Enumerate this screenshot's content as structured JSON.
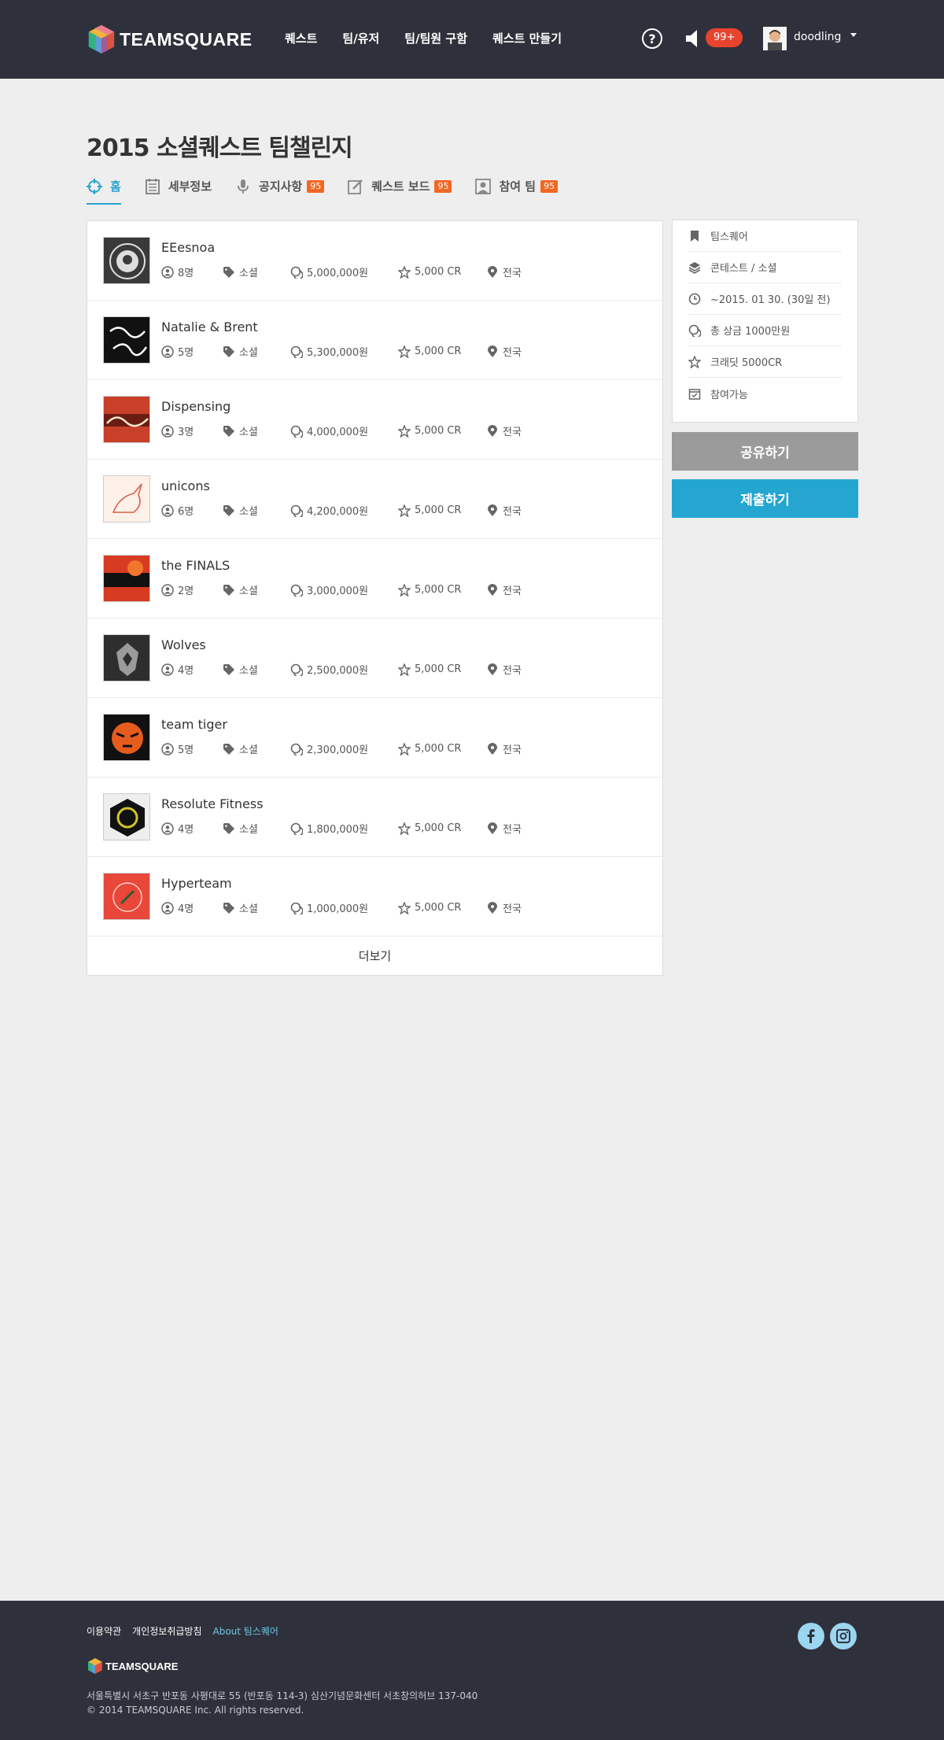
{
  "header": {
    "logo_text": "TEAMSQUARE",
    "nav": [
      "퀘스트",
      "팀/유저",
      "팀/팀원 구함",
      "퀘스트 만들기"
    ],
    "help_icon": "?",
    "notification_badge": "99+",
    "username": "doodling"
  },
  "page": {
    "title": "2015 소셜퀘스트 팀챌린지",
    "tabs": [
      {
        "label": "홈",
        "icon": "crosshair-icon"
      },
      {
        "label": "세부정보",
        "icon": "notepad-icon"
      },
      {
        "label": "공지사항",
        "icon": "microphone-icon",
        "badge": "95"
      },
      {
        "label": "퀘스트 보드",
        "icon": "edit-icon",
        "badge": "95"
      },
      {
        "label": "참여 팀",
        "icon": "person-icon",
        "badge": "95"
      }
    ]
  },
  "teams": [
    {
      "name": "EEesnoa",
      "members": "8명",
      "category": "소셜",
      "prize": "5,000,000원",
      "credit": "5,000 CR",
      "region": "전국"
    },
    {
      "name": "Natalie & Brent",
      "members": "5명",
      "category": "소셜",
      "prize": "5,300,000원",
      "credit": "5,000 CR",
      "region": "전국"
    },
    {
      "name": "Dispensing",
      "members": "3명",
      "category": "소셜",
      "prize": "4,000,000원",
      "credit": "5,000 CR",
      "region": "전국"
    },
    {
      "name": "unicons",
      "members": "6명",
      "category": "소셜",
      "prize": "4,200,000원",
      "credit": "5,000 CR",
      "region": "전국"
    },
    {
      "name": "the FINALS",
      "members": "2명",
      "category": "소셜",
      "prize": "3,000,000원",
      "credit": "5,000 CR",
      "region": "전국"
    },
    {
      "name": "Wolves",
      "members": "4명",
      "category": "소셜",
      "prize": "2,500,000원",
      "credit": "5,000 CR",
      "region": "전국"
    },
    {
      "name": "team tiger",
      "members": "5명",
      "category": "소셜",
      "prize": "2,300,000원",
      "credit": "5,000 CR",
      "region": "전국"
    },
    {
      "name": "Resolute Fitness",
      "members": "4명",
      "category": "소셜",
      "prize": "1,800,000원",
      "credit": "5,000 CR",
      "region": "전국"
    },
    {
      "name": "Hyperteam",
      "members": "4명",
      "category": "소셜",
      "prize": "1,000,000원",
      "credit": "5,000 CR",
      "region": "전국"
    }
  ],
  "more_label": "더보기",
  "side": {
    "rows": [
      {
        "icon": "bookmark-icon",
        "text": "팀스퀘어"
      },
      {
        "icon": "layers-icon",
        "text": "콘테스트 / 소셜"
      },
      {
        "icon": "clock-icon",
        "text": "~2015. 01 30. (30일 전)"
      },
      {
        "icon": "coins-icon",
        "text": "총 상금 1000만원"
      },
      {
        "icon": "star-icon",
        "text": "크래딧 5000CR"
      },
      {
        "icon": "calendar-check-icon",
        "text": "참여가능"
      }
    ],
    "share_label": "공유하기",
    "submit_label": "제출하기"
  },
  "footer": {
    "links": [
      "이용약관",
      "개인정보취급방침",
      "About 팀스퀘어"
    ],
    "logo_text": "TEAMSQUARE",
    "address": "서울특별시 서초구 반포동 사평대로 55 (반포동 114-3) 심산기념문화센터 서초창의허브 137-040",
    "copyright": "© 2014 TEAMSQUARE Inc. All rights reserved."
  },
  "colors": {
    "header_bg": "#2e313b",
    "accent_blue": "#24a6d1",
    "badge_orange": "#f26722",
    "badge_red": "#e8432e",
    "share_gray": "#9b9b9b"
  }
}
